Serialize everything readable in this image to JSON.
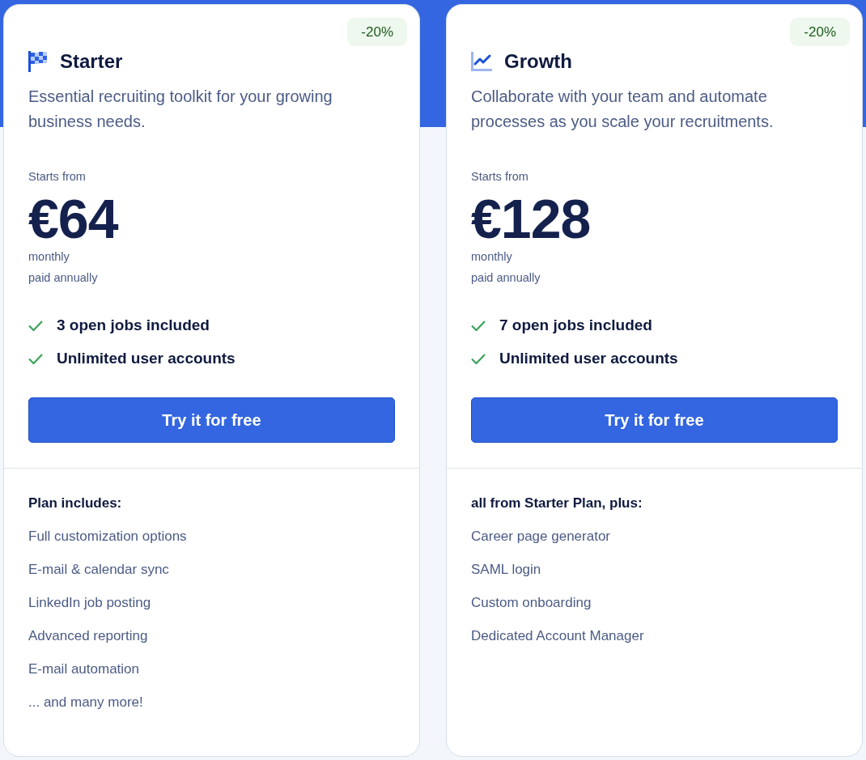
{
  "plans": [
    {
      "kind": "starter",
      "badge": "-20%",
      "name": "Starter",
      "description": "Essential recruiting toolkit for your growing business needs.",
      "price_label": "Starts from",
      "price": "€64",
      "period": "monthly",
      "billing": "paid annually",
      "highlights": [
        "3 open jobs included",
        "Unlimited user accounts"
      ],
      "button": "Try it for free",
      "includes_heading": "Plan includes:",
      "includes": [
        "Full customization options",
        "E-mail & calendar sync",
        "LinkedIn job posting",
        "Advanced reporting",
        "E-mail automation",
        "... and many more!"
      ]
    },
    {
      "kind": "growth",
      "badge": "-20%",
      "name": "Growth",
      "description": "Collaborate with your team and automate processes as you scale your recruitments.",
      "price_label": "Starts from",
      "price": "€128",
      "period": "monthly",
      "billing": "paid annually",
      "highlights": [
        "7 open jobs included",
        "Unlimited user accounts"
      ],
      "button": "Try it for free",
      "includes_heading": "all from Starter Plan, plus:",
      "includes": [
        "Career page generator",
        "SAML login",
        "Custom onboarding",
        "Dedicated Account Manager"
      ]
    }
  ]
}
